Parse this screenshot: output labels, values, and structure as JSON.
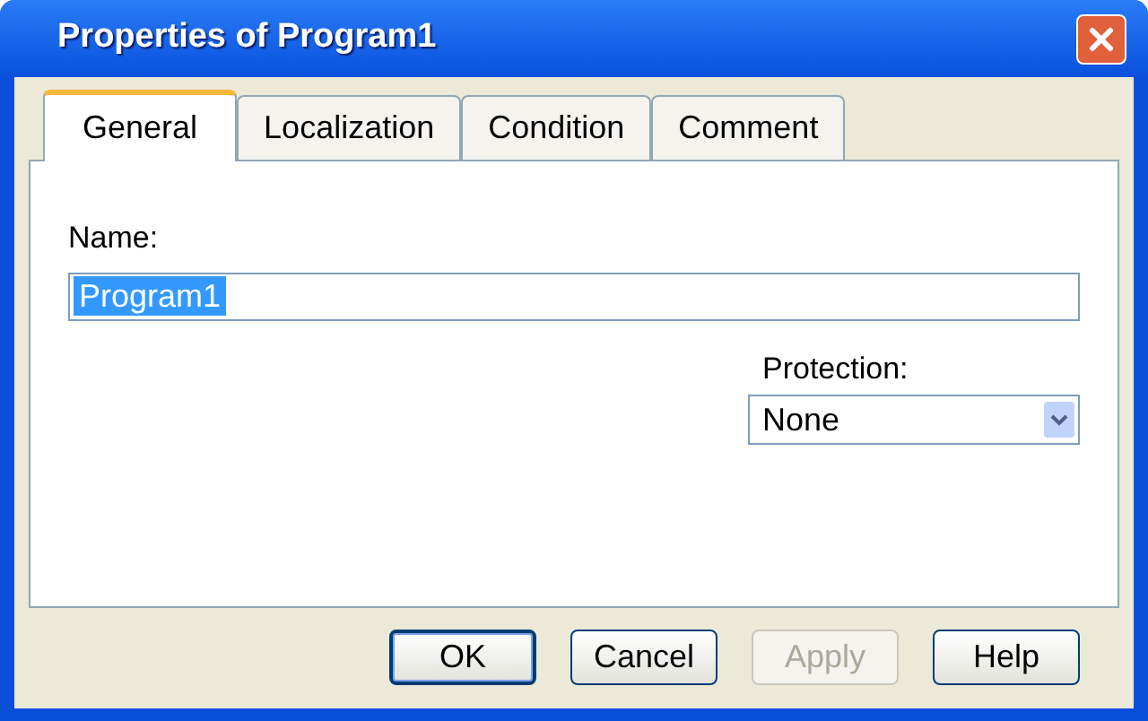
{
  "window": {
    "title": "Properties of Program1"
  },
  "tabs": [
    {
      "label": "General",
      "selected": true
    },
    {
      "label": "Localization",
      "selected": false
    },
    {
      "label": "Condition",
      "selected": false
    },
    {
      "label": "Comment",
      "selected": false
    }
  ],
  "name_field": {
    "label": "Name:",
    "value": "Program1",
    "selected": true
  },
  "protection": {
    "label": "Protection:",
    "value": "None"
  },
  "buttons": [
    {
      "label": "OK",
      "default": true,
      "disabled": false
    },
    {
      "label": "Cancel",
      "default": false,
      "disabled": false
    },
    {
      "label": "Apply",
      "default": false,
      "disabled": true
    },
    {
      "label": "Help",
      "default": false,
      "disabled": false
    }
  ]
}
